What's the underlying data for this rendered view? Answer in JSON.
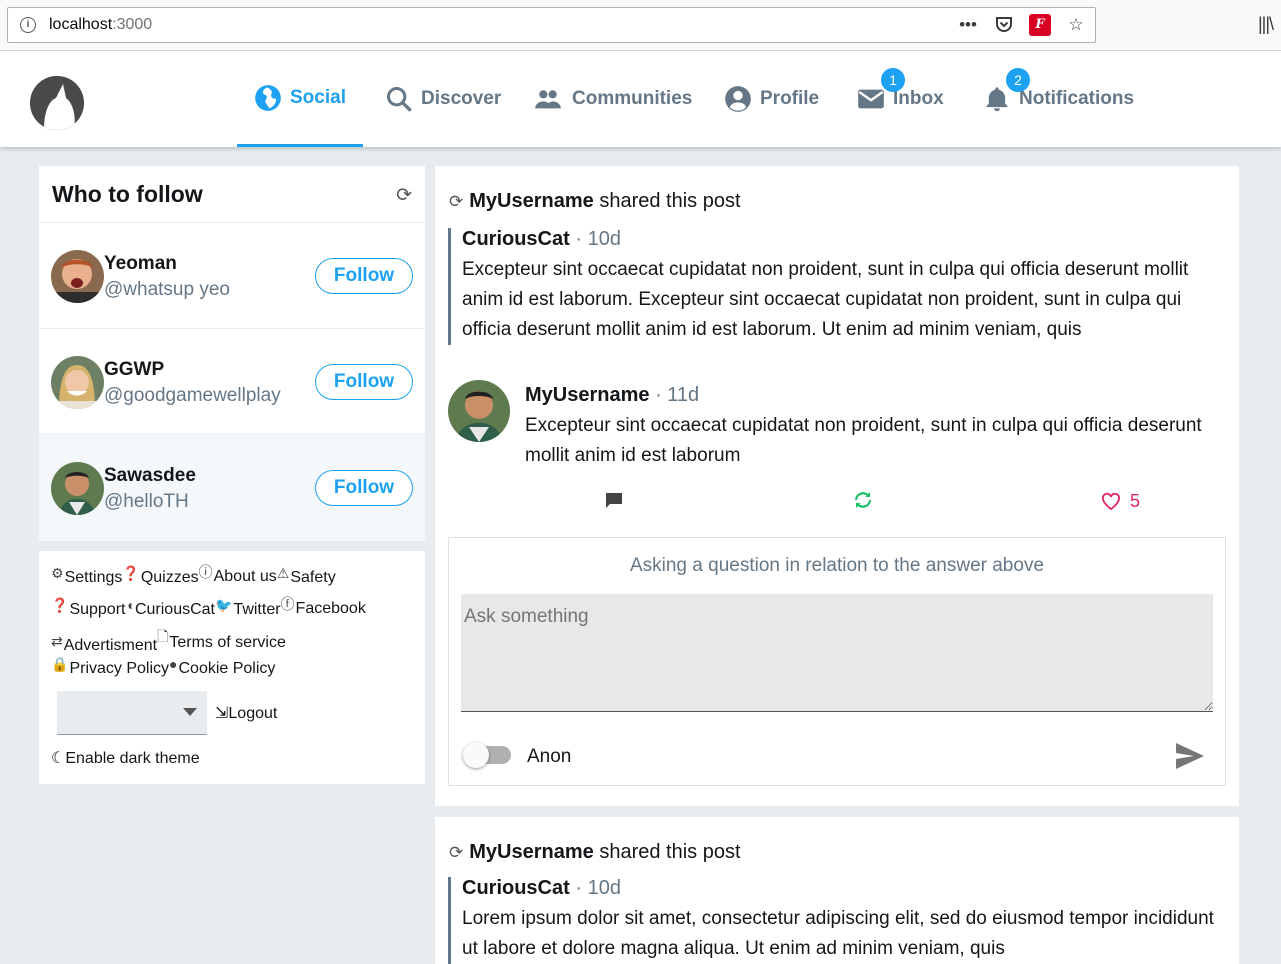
{
  "browser": {
    "url_host": "localhost",
    "url_port": ":3000",
    "actions": [
      "more-icon",
      "pocket-icon",
      "extension-icon",
      "bookmark-star-icon"
    ]
  },
  "nav": {
    "items": [
      {
        "label": "Social",
        "icon": "globe-icon",
        "active": true
      },
      {
        "label": "Discover",
        "icon": "search-icon"
      },
      {
        "label": "Communities",
        "icon": "people-icon"
      },
      {
        "label": "Profile",
        "icon": "account-icon"
      },
      {
        "label": "Inbox",
        "icon": "mail-icon",
        "badge": "1"
      },
      {
        "label": "Notifications",
        "icon": "bell-icon",
        "badge": "2"
      }
    ],
    "accent": "#1da1f2"
  },
  "who_to_follow": {
    "title": "Who to follow",
    "follow_label": "Follow",
    "users": [
      {
        "name": "Yeoman",
        "handle": "@whatsup yeo"
      },
      {
        "name": "GGWP",
        "handle": "@goodgamewellplay"
      },
      {
        "name": "Sawasdee",
        "handle": "@helloTH"
      }
    ]
  },
  "footer": {
    "links": [
      "Settings",
      "Quizzes",
      "About us",
      "Safety",
      "Support",
      "CuriousCat",
      "Twitter",
      "Facebook",
      "Advertisment",
      "Terms of service",
      "Privacy Policy",
      "Cookie Policy"
    ],
    "logout_label": "Logout",
    "dark_theme_label": "Enable dark theme"
  },
  "feed": {
    "post1": {
      "sharer": "MyUsername",
      "shared_text": "shared this post",
      "quote": {
        "author": "CuriousCat",
        "time": "· 10d",
        "text": "Excepteur sint occaecat cupidatat non proident, sunt in culpa qui officia deserunt mollit anim id est laborum. Excepteur sint occaecat cupidatat non proident, sunt in culpa qui officia deserunt mollit anim id est laborum. Ut enim ad minim veniam, quis"
      },
      "reply": {
        "author": "MyUsername",
        "time": "· 11d",
        "text": "Excepteur sint occaecat cupidatat non proident, sunt in culpa qui officia deserunt mollit anim id est laborum"
      },
      "likes": "5",
      "ask": {
        "title": "Asking a question in relation to the answer above",
        "placeholder": "Ask something",
        "anon_label": "Anon"
      }
    },
    "post2": {
      "sharer": "MyUsername",
      "shared_text": "shared this post",
      "quote": {
        "author": "CuriousCat",
        "time": "· 10d",
        "text": "Lorem ipsum dolor sit amet, consectetur adipiscing elit, sed do eiusmod tempor incididunt ut labore et dolore magna aliqua. Ut enim ad minim veniam, quis"
      }
    }
  },
  "colors": {
    "like": "#e0245e",
    "share": "#17bf63",
    "muted": "#657786"
  }
}
